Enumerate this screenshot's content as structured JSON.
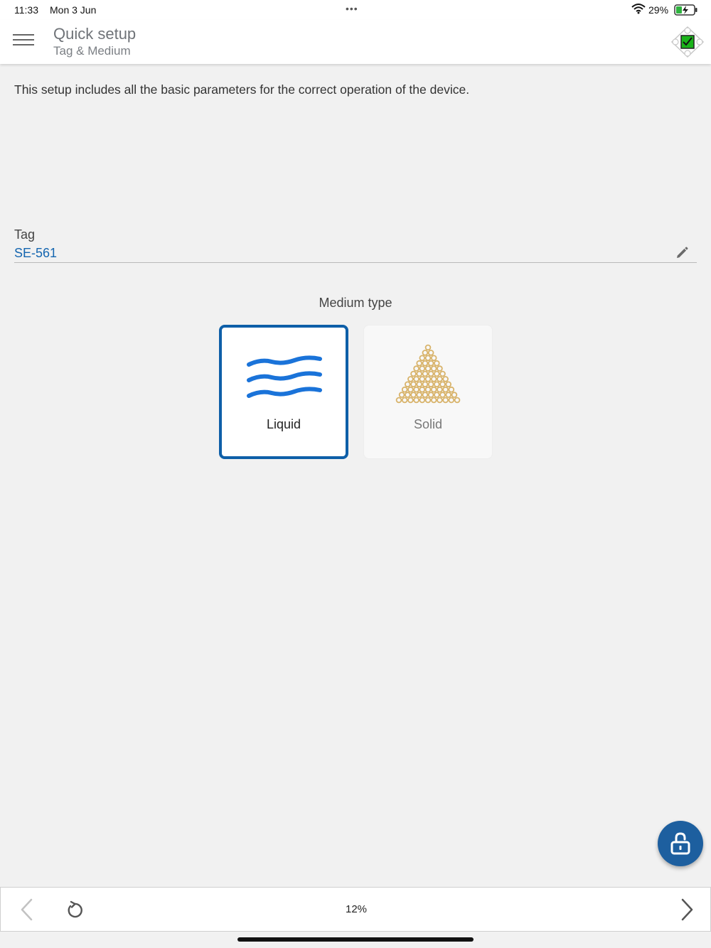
{
  "status_bar": {
    "time": "11:33",
    "date": "Mon 3 Jun",
    "multitask_dots": "•••",
    "battery_percent": "29%",
    "icons": [
      "wifi-icon",
      "battery-charging-icon"
    ]
  },
  "app_bar": {
    "title": "Quick setup",
    "subtitle": "Tag & Medium",
    "icons": [
      "hamburger-menu-icon",
      "device-status-icon"
    ],
    "status_color": "#19b319"
  },
  "content": {
    "intro_text": "This setup includes all the basic parameters for the correct operation of the device.",
    "tag": {
      "label": "Tag",
      "value": "SE-561",
      "icon": "pencil-edit-icon"
    },
    "medium": {
      "title": "Medium type",
      "options": [
        {
          "label": "Liquid",
          "icon": "waves-icon",
          "selected": true,
          "color": "#1a73d9"
        },
        {
          "label": "Solid",
          "icon": "pile-of-granules-icon",
          "selected": false,
          "color": "#d8b36a"
        }
      ]
    }
  },
  "fab": {
    "icon": "lock-open-icon",
    "color": "#1d5f9f"
  },
  "bottom_bar": {
    "progress_text": "12%",
    "icons": [
      "chevron-left-icon",
      "reset-icon",
      "chevron-right-icon"
    ]
  },
  "colors": {
    "accent": "#0e5fa8",
    "link": "#1566b0",
    "background": "#f1f1f1"
  }
}
